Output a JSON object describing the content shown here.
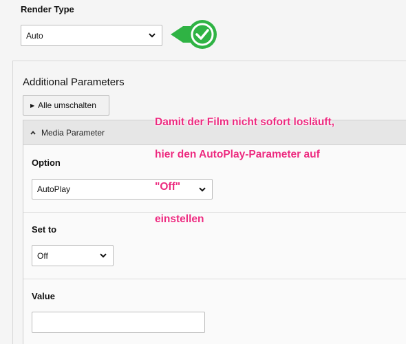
{
  "render_type": {
    "label": "Render Type",
    "value": "Auto"
  },
  "additional_parameters": {
    "title": "Additional Parameters",
    "toggle_all_label": "Alle umschalten"
  },
  "media_panel": {
    "header": "Media Parameter",
    "option": {
      "label": "Option",
      "value": "AutoPlay"
    },
    "set_to": {
      "label": "Set to",
      "value": "Off"
    },
    "value_field": {
      "label": "Value",
      "value": ""
    }
  },
  "annotation": {
    "line1": "Damit der Film nicht sofort losläuft,",
    "line2": "hier den AutoPlay-Parameter auf",
    "line3": "\"Off\"",
    "line4": "einstellen"
  },
  "colors": {
    "annotation": "#ec2a7f",
    "callout_green": "#2fb344"
  },
  "icons": {
    "callout": "check-icon",
    "select_arrow": "chevron-down-icon",
    "panel_caret": "chevron-up-icon",
    "toggle_button": "triangle-right-icon"
  }
}
